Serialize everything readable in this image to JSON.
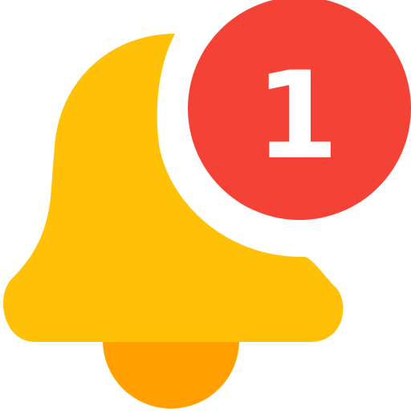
{
  "icon": {
    "name": "notification-bell-icon",
    "colors": {
      "bell_body": "#FFC107",
      "bell_clapper": "#FF9F00",
      "badge": "#F44336",
      "badge_text": "#FFFFFF",
      "badge_ring": "#FFFFFF"
    }
  },
  "badge": {
    "count": "1"
  }
}
